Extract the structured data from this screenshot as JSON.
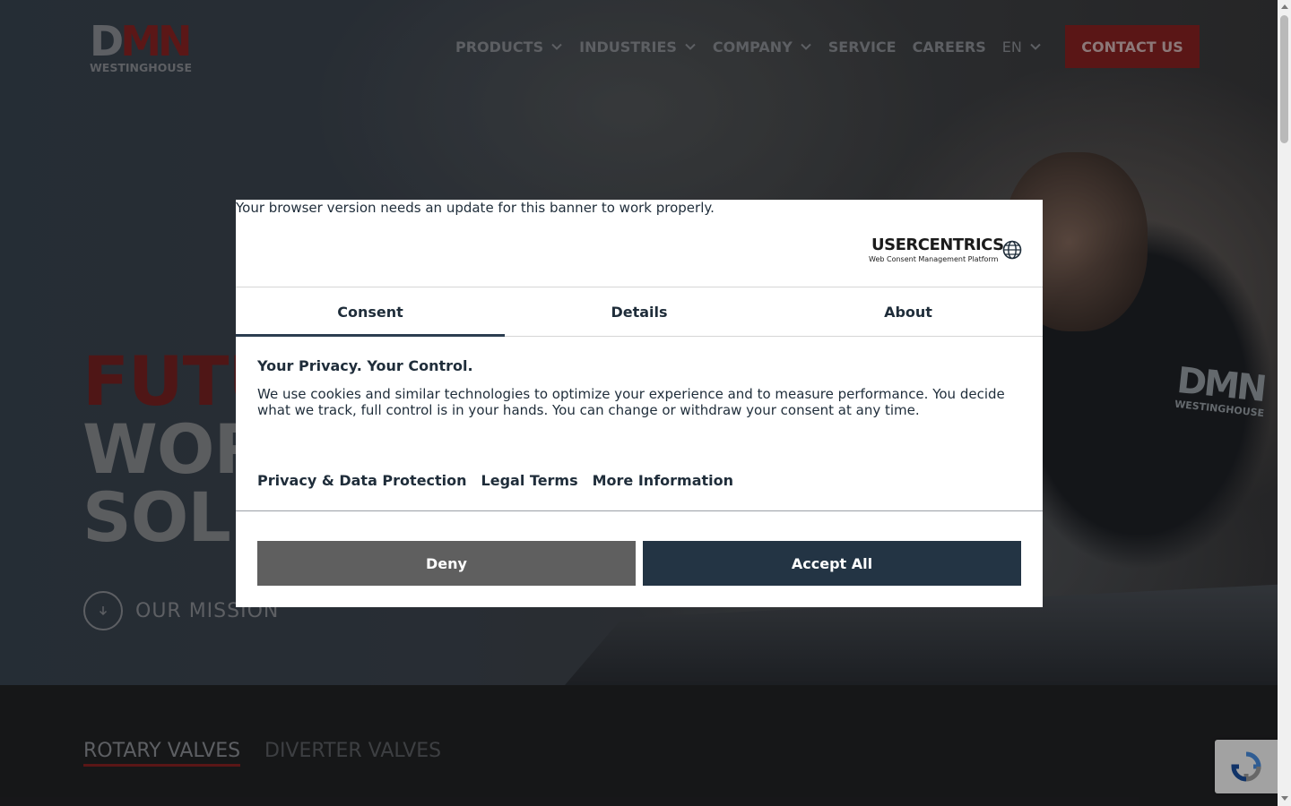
{
  "site": {
    "logo": {
      "mark_d": "D",
      "mark_mn": "MN",
      "subtitle": "WESTINGHOUSE"
    },
    "nav": [
      {
        "label": "PRODUCTS",
        "has_dropdown": true
      },
      {
        "label": "INDUSTRIES",
        "has_dropdown": true
      },
      {
        "label": "COMPANY",
        "has_dropdown": true
      },
      {
        "label": "SERVICE",
        "has_dropdown": false
      },
      {
        "label": "CAREERS",
        "has_dropdown": false
      }
    ],
    "language": "EN",
    "contact_label": "CONTACT US",
    "hero": {
      "line1": "FUTU",
      "line2": "WOR",
      "line3": "SOLI",
      "mission_label": "OUR MISSION"
    },
    "jacket_logo": {
      "mark": "DMN",
      "subtitle": "WESTINGHOUSE"
    },
    "tabs": [
      {
        "label": "ROTARY VALVES",
        "active": true
      },
      {
        "label": "DIVERTER VALVES",
        "active": false
      }
    ],
    "colors": {
      "brand_red": "#8a2222",
      "text_grey": "#8f9399"
    }
  },
  "consent": {
    "browser_warning": "Your browser version needs an update for this banner to work properly.",
    "provider": {
      "name": "USERCENTRICS",
      "tagline": "Web Consent Management Platform"
    },
    "tabs": [
      {
        "label": "Consent",
        "active": true
      },
      {
        "label": "Details",
        "active": false
      },
      {
        "label": "About",
        "active": false
      }
    ],
    "heading": "Your Privacy. Your Control.",
    "body": "We use cookies and similar technologies to optimize your experience and to measure performance. You decide what we track, full control is in your hands. You can change or withdraw your consent at any time.",
    "links": [
      "Privacy & Data Protection",
      "Legal Terms",
      "More Information"
    ],
    "deny_label": "Deny",
    "accept_label": "Accept All",
    "colors": {
      "accept_bg": "#233444",
      "deny_bg": "#5f5f5f"
    }
  }
}
